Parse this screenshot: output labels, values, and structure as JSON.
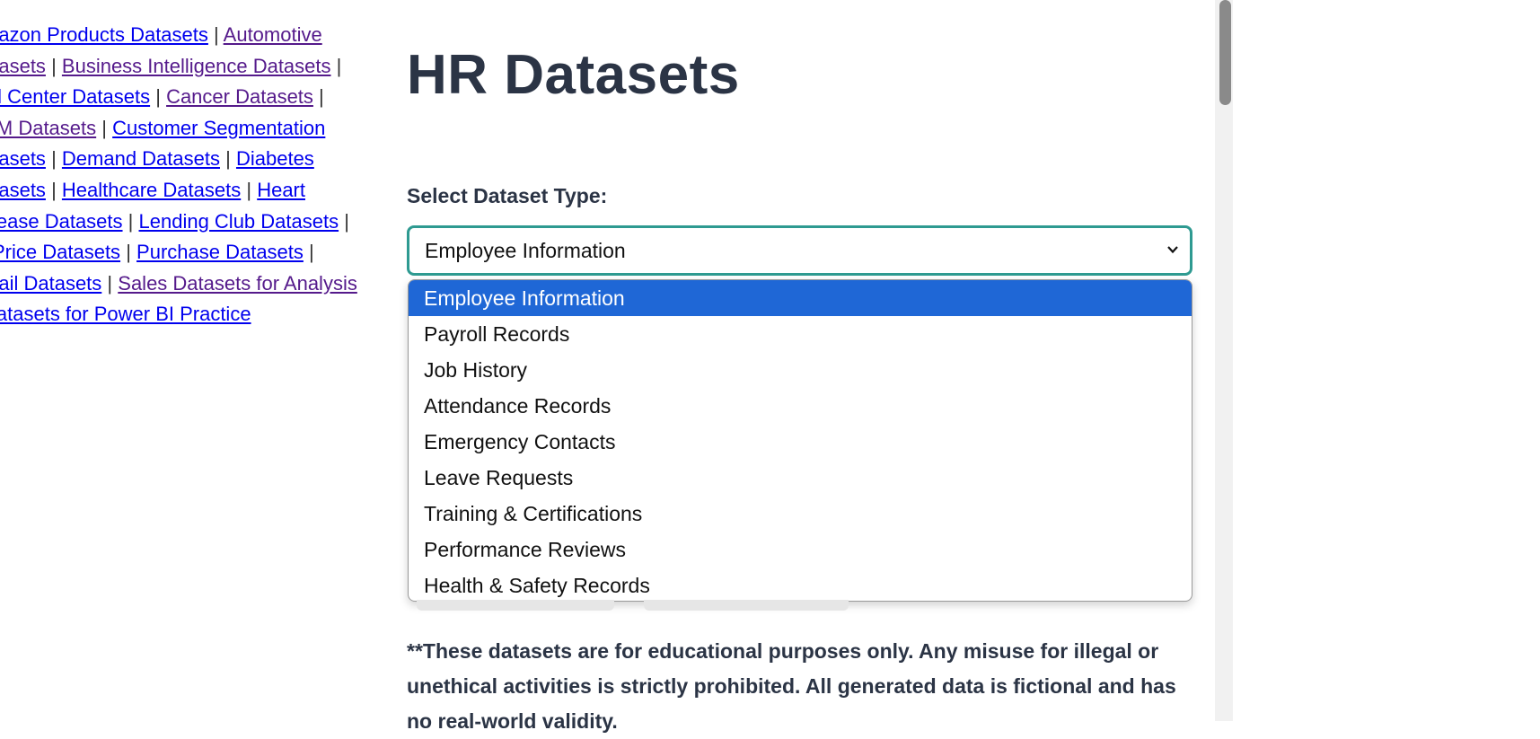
{
  "sidebar": {
    "links": [
      {
        "text": "mazon Products Datasets",
        "visited": false
      },
      {
        "text": "Automotive Datasets",
        "visited": true,
        "first": "Automotive",
        "second": "atasets"
      },
      {
        "text": "Business Intelligence Datasets",
        "visited": true
      },
      {
        "text": "all Center Datasets",
        "visited": false
      },
      {
        "text": "Cancer Datasets",
        "visited": true
      },
      {
        "text": "RM Datasets",
        "visited": true
      },
      {
        "text": "Customer Segmentation Datasets",
        "visited": false,
        "first": "Customer Segmentation",
        "second": "atasets"
      },
      {
        "text": "Demand Datasets",
        "visited": false
      },
      {
        "text": "Diabetes Datasets",
        "visited": false,
        "first": "Diabetes",
        "second": "atasets"
      },
      {
        "text": "Healthcare Datasets",
        "visited": false
      },
      {
        "text": "Heart Disease Datasets",
        "visited": false,
        "first": "Heart",
        "second": "isease Datasets"
      },
      {
        "text": "Lending Club Datasets",
        "visited": false
      },
      {
        "text": "l Price Datasets",
        "visited": false
      },
      {
        "text": "Purchase Datasets",
        "visited": false
      },
      {
        "text": "etail Datasets",
        "visited": false
      },
      {
        "text": "Sales Datasets for Analysis",
        "visited": true
      },
      {
        "text": "Datasets for Power BI Practice",
        "visited": false
      }
    ],
    "separator": "|"
  },
  "main": {
    "title": "HR Datasets",
    "select_label": "Select Dataset Type:",
    "selected_value": "Employee Information",
    "options": [
      "Employee Information",
      "Payroll Records",
      "Job History",
      "Attendance Records",
      "Emergency Contacts",
      "Leave Requests",
      "Training & Certifications",
      "Performance Reviews",
      "Health & Safety Records"
    ],
    "disclaimer": "**These datasets are for educational purposes only. Any misuse for illegal or unethical activities is strictly prohibited. All generated data is fictional and has no real-world validity."
  },
  "colors": {
    "title": "#2b3445",
    "select_border": "#2e9a91",
    "option_highlight": "#1f67d6",
    "link": "#0000ee",
    "visited_link": "#551a8b"
  },
  "icons": {
    "select_arrow": "chevron-down-icon"
  }
}
